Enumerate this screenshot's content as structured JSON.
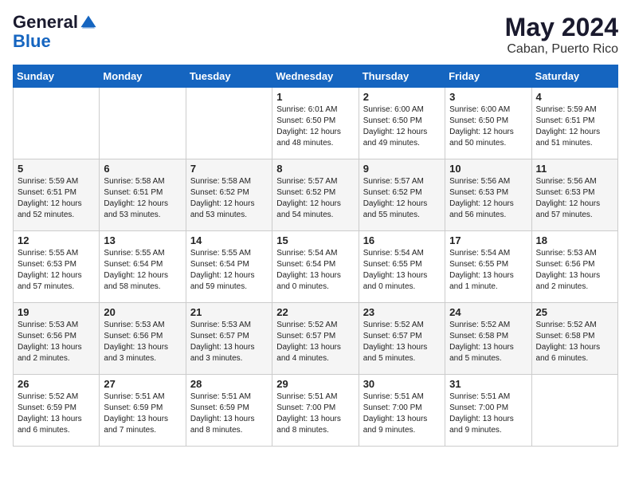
{
  "logo": {
    "line1": "General",
    "line2": "Blue"
  },
  "title": "May 2024",
  "location": "Caban, Puerto Rico",
  "days_header": [
    "Sunday",
    "Monday",
    "Tuesday",
    "Wednesday",
    "Thursday",
    "Friday",
    "Saturday"
  ],
  "weeks": [
    [
      {
        "day": "",
        "info": ""
      },
      {
        "day": "",
        "info": ""
      },
      {
        "day": "",
        "info": ""
      },
      {
        "day": "1",
        "info": "Sunrise: 6:01 AM\nSunset: 6:50 PM\nDaylight: 12 hours\nand 48 minutes."
      },
      {
        "day": "2",
        "info": "Sunrise: 6:00 AM\nSunset: 6:50 PM\nDaylight: 12 hours\nand 49 minutes."
      },
      {
        "day": "3",
        "info": "Sunrise: 6:00 AM\nSunset: 6:50 PM\nDaylight: 12 hours\nand 50 minutes."
      },
      {
        "day": "4",
        "info": "Sunrise: 5:59 AM\nSunset: 6:51 PM\nDaylight: 12 hours\nand 51 minutes."
      }
    ],
    [
      {
        "day": "5",
        "info": "Sunrise: 5:59 AM\nSunset: 6:51 PM\nDaylight: 12 hours\nand 52 minutes."
      },
      {
        "day": "6",
        "info": "Sunrise: 5:58 AM\nSunset: 6:51 PM\nDaylight: 12 hours\nand 53 minutes."
      },
      {
        "day": "7",
        "info": "Sunrise: 5:58 AM\nSunset: 6:52 PM\nDaylight: 12 hours\nand 53 minutes."
      },
      {
        "day": "8",
        "info": "Sunrise: 5:57 AM\nSunset: 6:52 PM\nDaylight: 12 hours\nand 54 minutes."
      },
      {
        "day": "9",
        "info": "Sunrise: 5:57 AM\nSunset: 6:52 PM\nDaylight: 12 hours\nand 55 minutes."
      },
      {
        "day": "10",
        "info": "Sunrise: 5:56 AM\nSunset: 6:53 PM\nDaylight: 12 hours\nand 56 minutes."
      },
      {
        "day": "11",
        "info": "Sunrise: 5:56 AM\nSunset: 6:53 PM\nDaylight: 12 hours\nand 57 minutes."
      }
    ],
    [
      {
        "day": "12",
        "info": "Sunrise: 5:55 AM\nSunset: 6:53 PM\nDaylight: 12 hours\nand 57 minutes."
      },
      {
        "day": "13",
        "info": "Sunrise: 5:55 AM\nSunset: 6:54 PM\nDaylight: 12 hours\nand 58 minutes."
      },
      {
        "day": "14",
        "info": "Sunrise: 5:55 AM\nSunset: 6:54 PM\nDaylight: 12 hours\nand 59 minutes."
      },
      {
        "day": "15",
        "info": "Sunrise: 5:54 AM\nSunset: 6:54 PM\nDaylight: 13 hours\nand 0 minutes."
      },
      {
        "day": "16",
        "info": "Sunrise: 5:54 AM\nSunset: 6:55 PM\nDaylight: 13 hours\nand 0 minutes."
      },
      {
        "day": "17",
        "info": "Sunrise: 5:54 AM\nSunset: 6:55 PM\nDaylight: 13 hours\nand 1 minute."
      },
      {
        "day": "18",
        "info": "Sunrise: 5:53 AM\nSunset: 6:56 PM\nDaylight: 13 hours\nand 2 minutes."
      }
    ],
    [
      {
        "day": "19",
        "info": "Sunrise: 5:53 AM\nSunset: 6:56 PM\nDaylight: 13 hours\nand 2 minutes."
      },
      {
        "day": "20",
        "info": "Sunrise: 5:53 AM\nSunset: 6:56 PM\nDaylight: 13 hours\nand 3 minutes."
      },
      {
        "day": "21",
        "info": "Sunrise: 5:53 AM\nSunset: 6:57 PM\nDaylight: 13 hours\nand 3 minutes."
      },
      {
        "day": "22",
        "info": "Sunrise: 5:52 AM\nSunset: 6:57 PM\nDaylight: 13 hours\nand 4 minutes."
      },
      {
        "day": "23",
        "info": "Sunrise: 5:52 AM\nSunset: 6:57 PM\nDaylight: 13 hours\nand 5 minutes."
      },
      {
        "day": "24",
        "info": "Sunrise: 5:52 AM\nSunset: 6:58 PM\nDaylight: 13 hours\nand 5 minutes."
      },
      {
        "day": "25",
        "info": "Sunrise: 5:52 AM\nSunset: 6:58 PM\nDaylight: 13 hours\nand 6 minutes."
      }
    ],
    [
      {
        "day": "26",
        "info": "Sunrise: 5:52 AM\nSunset: 6:59 PM\nDaylight: 13 hours\nand 6 minutes."
      },
      {
        "day": "27",
        "info": "Sunrise: 5:51 AM\nSunset: 6:59 PM\nDaylight: 13 hours\nand 7 minutes."
      },
      {
        "day": "28",
        "info": "Sunrise: 5:51 AM\nSunset: 6:59 PM\nDaylight: 13 hours\nand 8 minutes."
      },
      {
        "day": "29",
        "info": "Sunrise: 5:51 AM\nSunset: 7:00 PM\nDaylight: 13 hours\nand 8 minutes."
      },
      {
        "day": "30",
        "info": "Sunrise: 5:51 AM\nSunset: 7:00 PM\nDaylight: 13 hours\nand 9 minutes."
      },
      {
        "day": "31",
        "info": "Sunrise: 5:51 AM\nSunset: 7:00 PM\nDaylight: 13 hours\nand 9 minutes."
      },
      {
        "day": "",
        "info": ""
      }
    ]
  ]
}
